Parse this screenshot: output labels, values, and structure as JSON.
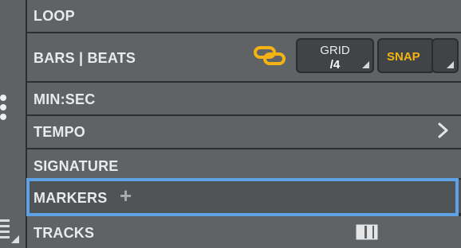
{
  "rows": {
    "loop": "LOOP",
    "bars_beats": "BARS | BEATS",
    "min_sec": "MIN:SEC",
    "tempo": "TEMPO",
    "signature": "SIGNATURE",
    "markers": "MARKERS",
    "tracks": "TRACKS"
  },
  "grid": {
    "label": "GRID",
    "value": "/4"
  },
  "snap": {
    "label": "SNAP"
  },
  "icons": {
    "link": "link-chain-icon",
    "chevron": "chevron-right-icon",
    "add": "plus-icon",
    "tracks_view": "tracks-view-icon",
    "menu": "more-vertical-icon",
    "list": "list-view-icon"
  },
  "colors": {
    "accent_yellow": "#f3b313",
    "selection_blue": "#5fa3e6",
    "row_bg": "#5f6365"
  },
  "plus_glyph": "+"
}
